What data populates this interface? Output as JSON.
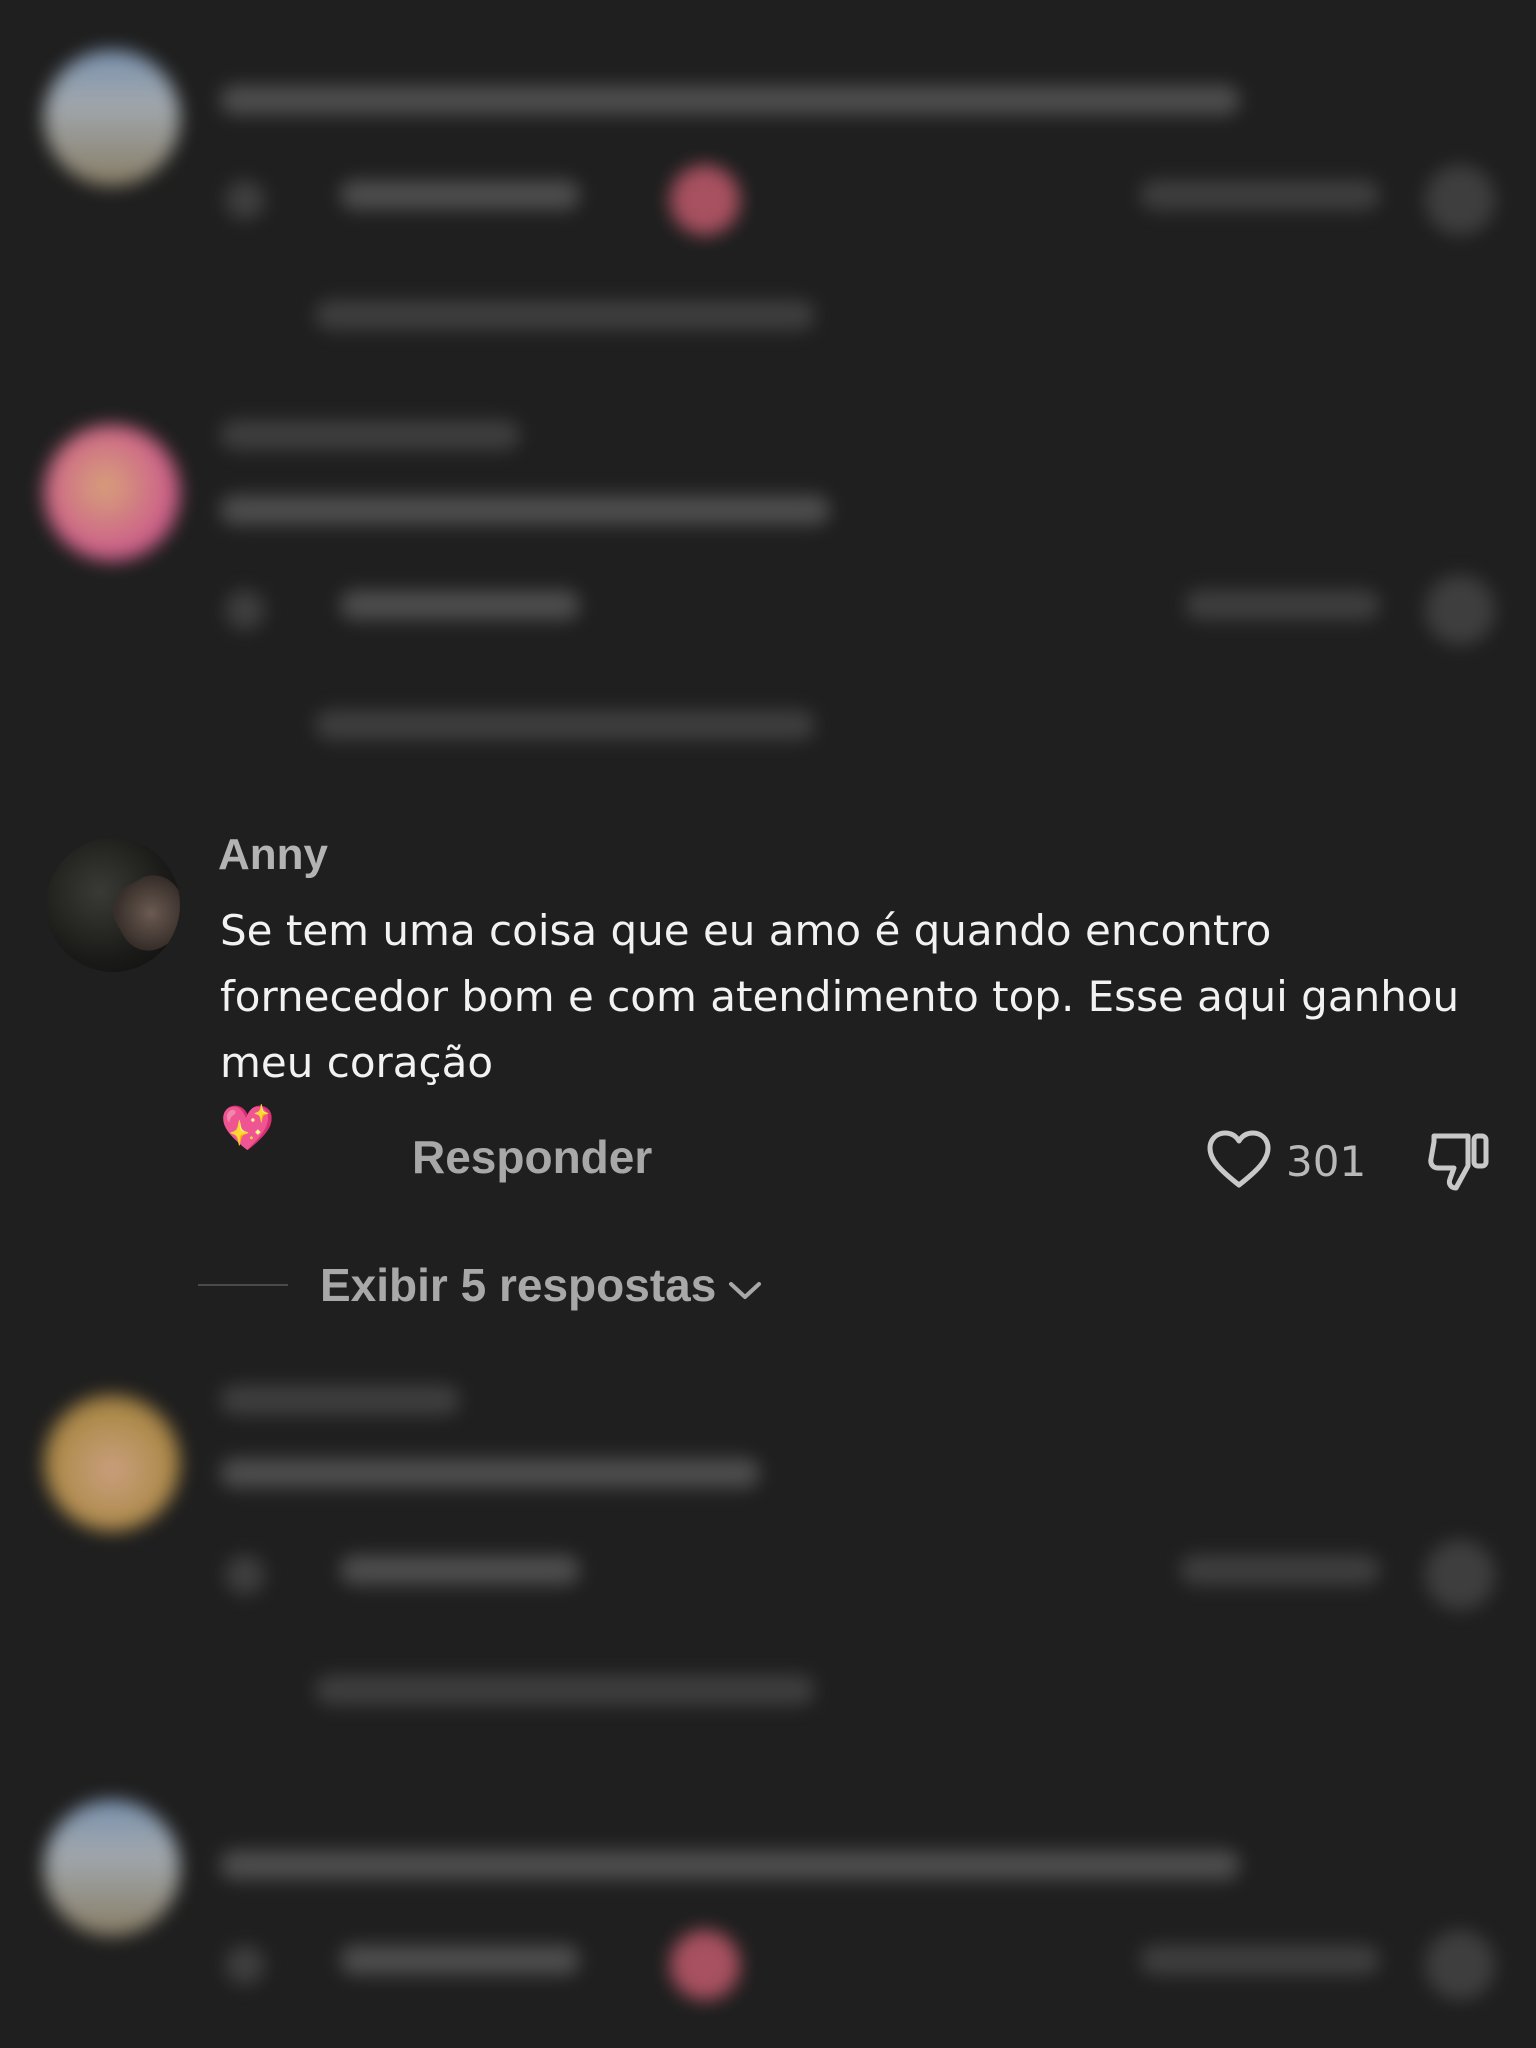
{
  "comment": {
    "author": "Anny",
    "text": "Se tem uma coisa que eu amo é quando encontro fornecedor bom e com atendimento top. Esse aqui ganhou meu coração",
    "emoji": "💖",
    "reply_label": "Responder",
    "like_count": "301",
    "view_replies_label": "Exibir 5 respostas"
  },
  "icons": {
    "like": "heart-outline-icon",
    "dislike": "thumbs-down-icon",
    "expand": "chevron-down-icon"
  },
  "colors": {
    "background": "#1f1f1f",
    "text_primary": "#f2f2f2",
    "text_secondary": "#a8a8a8"
  }
}
